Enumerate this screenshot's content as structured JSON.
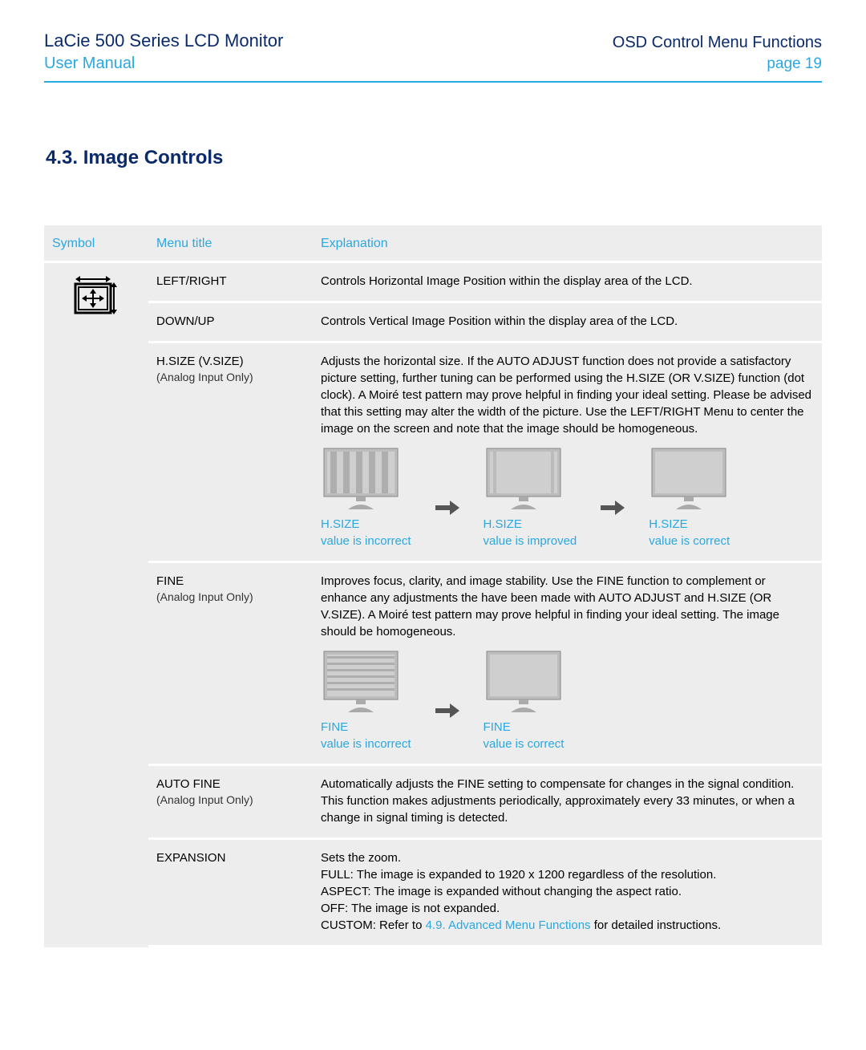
{
  "header": {
    "title": "LaCie 500 Series LCD Monitor",
    "subtitle": "User Manual",
    "section": "OSD Control Menu Functions",
    "page_label": "page 19"
  },
  "section_heading": "4.3.  Image Controls",
  "table_headers": {
    "symbol": "Symbol",
    "menu_title": "Menu title",
    "explanation": "Explanation"
  },
  "rows": {
    "r1": {
      "menu": "LEFT/RIGHT",
      "sub": "",
      "text": "Controls Horizontal Image Position within the display area of the LCD."
    },
    "r2": {
      "menu": "DOWN/UP",
      "sub": "",
      "text": "Controls Vertical Image Position within the display area of the LCD."
    },
    "r3": {
      "menu": "H.SIZE (V.SIZE)",
      "sub": "(Analog Input Only)",
      "text": "Adjusts the horizontal size. If the AUTO ADJUST function does not provide a satisfactory picture setting, further tuning can be performed using the H.SIZE (OR V.SIZE) function (dot clock). A Moiré test pattern may prove helpful in finding your ideal setting. Please be advised that this setting may alter the width of the picture. Use the LEFT/RIGHT Menu to center the image on the screen and note that the image should be homogeneous.",
      "captions": {
        "a_title": "H.SIZE",
        "a_sub": "value is incorrect",
        "b_title": "H.SIZE",
        "b_sub": "value is improved",
        "c_title": "H.SIZE",
        "c_sub": "value is correct"
      }
    },
    "r4": {
      "menu": "FINE",
      "sub": "(Analog Input Only)",
      "text": "Improves focus, clarity, and image stability. Use the FINE function to complement or enhance any adjustments the have been made with AUTO ADJUST and H.SIZE (OR V.SIZE). A Moiré test pattern may prove helpful in finding your ideal setting. The image should be homogeneous.",
      "captions": {
        "a_title": "FINE",
        "a_sub": "value is incorrect",
        "b_title": "FINE",
        "b_sub": "value is correct"
      }
    },
    "r5": {
      "menu": "AUTO FINE",
      "sub": "(Analog Input Only)",
      "text": "Automatically adjusts the FINE setting to compensate for changes in the signal condition. This function makes adjustments periodically, approximately every 33 minutes, or when a change in signal timing is detected."
    },
    "r6": {
      "menu": "EXPANSION",
      "sub": "",
      "text_l1": "Sets the zoom.",
      "text_l2": "FULL: The image is expanded to 1920 x 1200 regardless of the resolution.",
      "text_l3": "ASPECT: The image is expanded without changing the aspect ratio.",
      "text_l4": "OFF: The image is not expanded.",
      "text_l5a": "CUSTOM: Refer to ",
      "text_l5_link": "4.9. Advanced Menu Functions",
      "text_l5b": " for detailed instructions."
    }
  }
}
